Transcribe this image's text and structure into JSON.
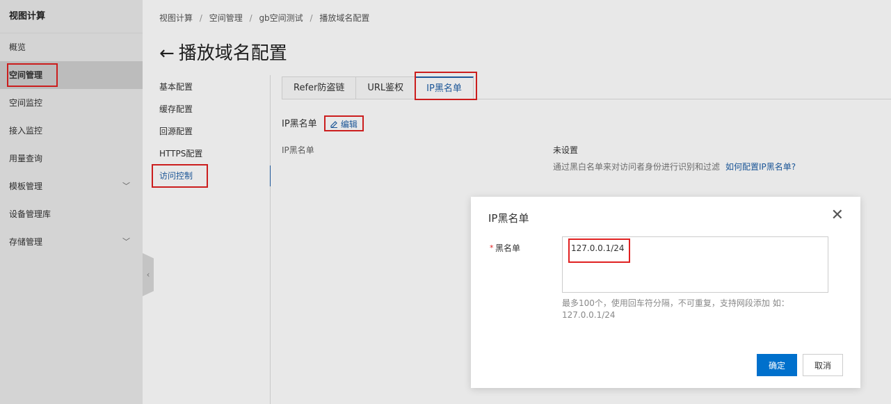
{
  "nav": {
    "product": "视图计算",
    "items": [
      {
        "label": "概览"
      },
      {
        "label": "空间管理"
      },
      {
        "label": "空间监控"
      },
      {
        "label": "接入监控"
      },
      {
        "label": "用量查询"
      },
      {
        "label": "模板管理"
      },
      {
        "label": "设备管理库"
      },
      {
        "label": "存储管理"
      }
    ],
    "active": "空间管理"
  },
  "breadcrumb": [
    "视图计算",
    "空间管理",
    "gb空间测试",
    "播放域名配置"
  ],
  "breadcrumb_sep": "/",
  "page": {
    "back_arrow": "←",
    "title": "播放域名配置"
  },
  "subnav": {
    "items": [
      {
        "label": "基本配置"
      },
      {
        "label": "缓存配置"
      },
      {
        "label": "回源配置"
      },
      {
        "label": "HTTPS配置"
      },
      {
        "label": "访问控制"
      }
    ],
    "active": "访问控制"
  },
  "tabs": {
    "items": [
      {
        "label": "Refer防盗链"
      },
      {
        "label": "URL鉴权"
      },
      {
        "label": "IP黑名单"
      }
    ],
    "active": "IP黑名单"
  },
  "section": {
    "title": "IP黑名单",
    "edit_label": "编辑",
    "field_label": "IP黑名单",
    "field_value": "未设置",
    "hint": "通过黑白名单来对访问者身份进行识别和过滤",
    "hint_link": "如何配置IP黑名单?"
  },
  "modal": {
    "title": "IP黑名单",
    "close_glyph": "✕",
    "required_mark": "*",
    "field_label": "黑名单",
    "value": "127.0.0.1/24",
    "help": "最多100个，使用回车符分隔，不可重复，支持网段添加 如：127.0.0.1/24",
    "ok_label": "确定",
    "cancel_label": "取消"
  },
  "colors": {
    "accent": "#0070cc",
    "link": "#1f5fa6",
    "highlight": "#e02020"
  }
}
